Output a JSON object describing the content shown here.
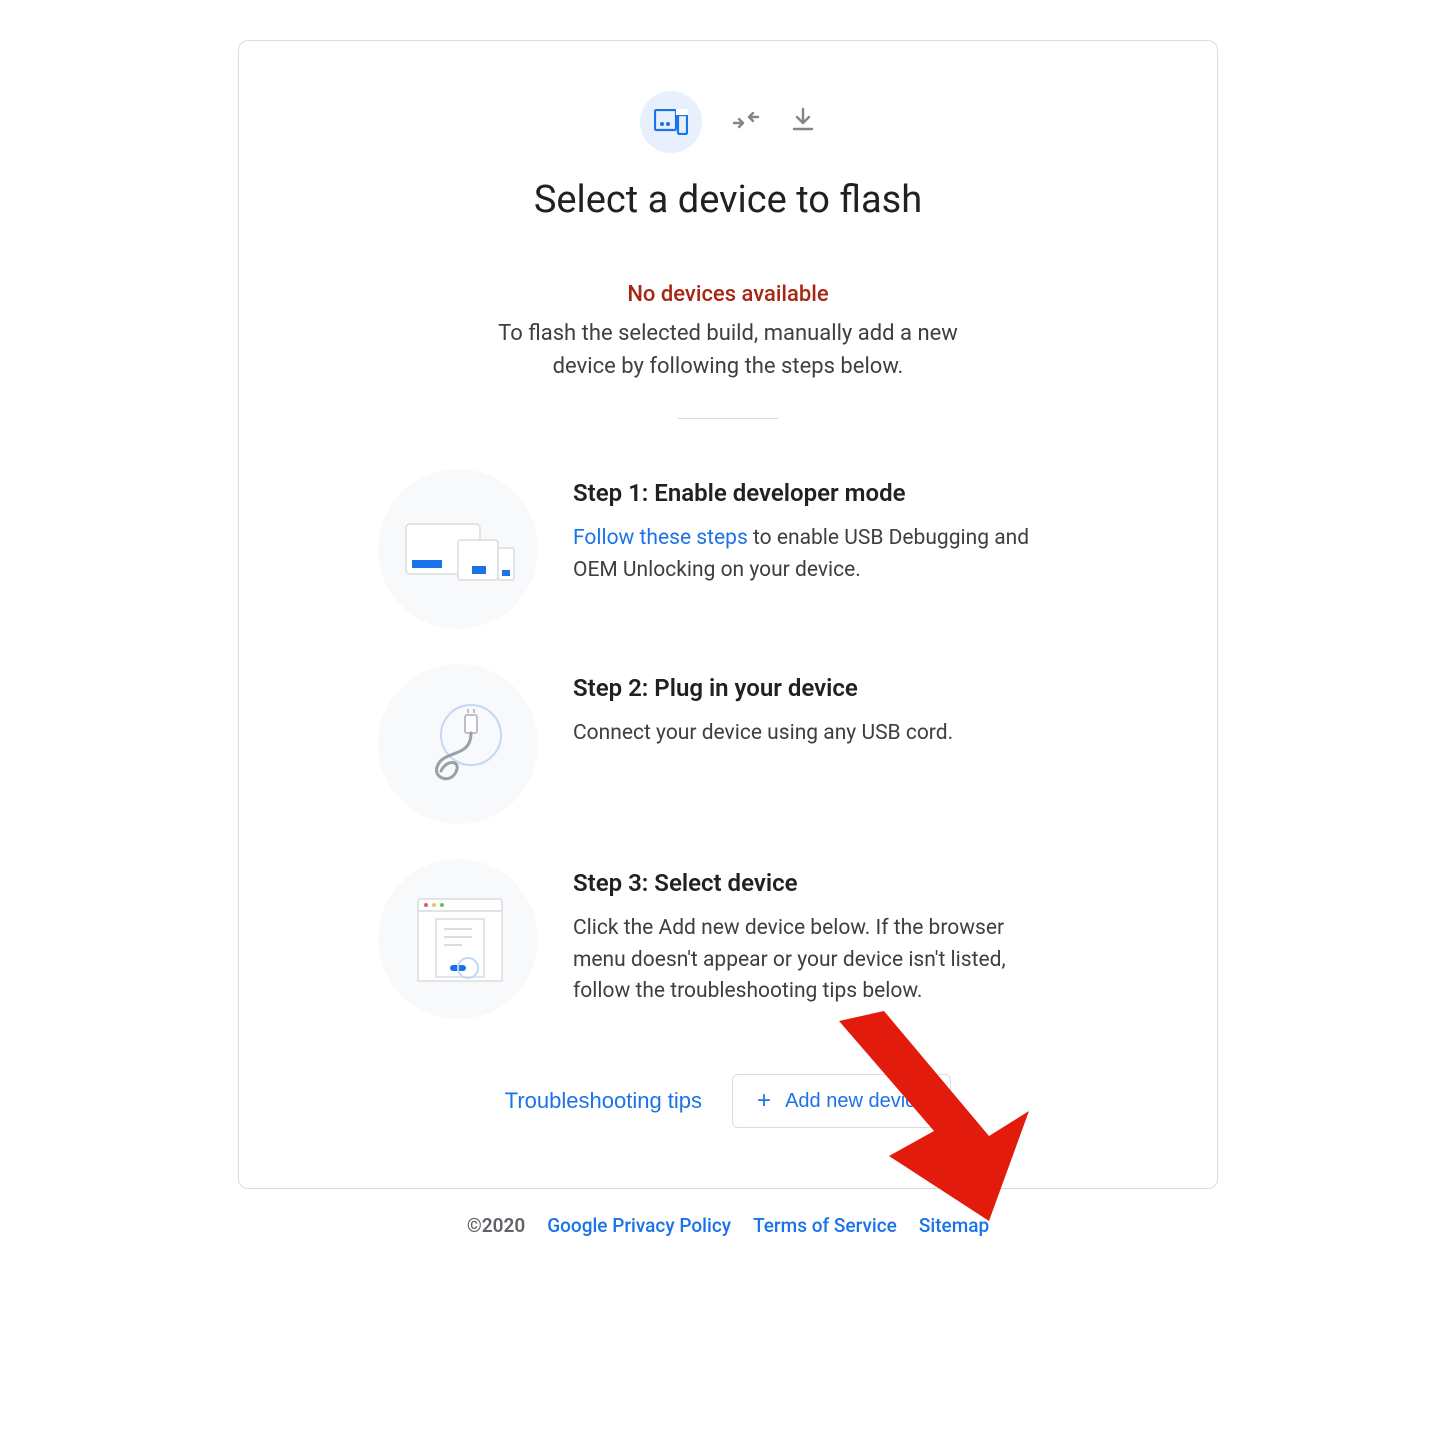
{
  "header": {
    "title": "Select a device to flash"
  },
  "status": {
    "warning": "No devices available",
    "desc": "To flash the selected build, manually add a new device by following the steps below."
  },
  "steps": [
    {
      "heading": "Step 1: Enable developer mode",
      "link_text": "Follow these steps",
      "body_tail": " to enable USB Debugging and OEM Unlocking on your device."
    },
    {
      "heading": "Step 2: Plug in your device",
      "body": "Connect your device using any USB cord."
    },
    {
      "heading": "Step 3: Select device",
      "body": "Click the Add new device below. If the browser menu doesn't appear or your device isn't listed, follow the troubleshooting tips below."
    }
  ],
  "buttons": {
    "troubleshooting": "Troubleshooting tips",
    "add_device": "Add new device"
  },
  "footer": {
    "copyright": "©2020",
    "links": [
      "Google Privacy Policy",
      "Terms of Service",
      "Sitemap"
    ]
  },
  "annotation": {
    "arrow_color": "#e31b0c"
  }
}
